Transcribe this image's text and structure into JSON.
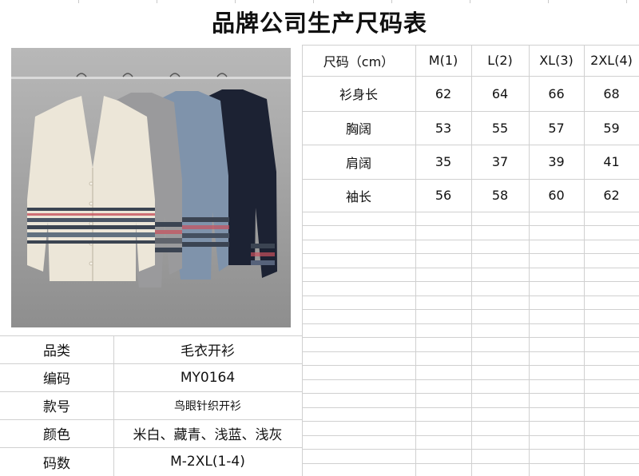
{
  "title": "品牌公司生产尺码表",
  "size_table": {
    "header_label": "尺码（cm）",
    "sizes": [
      "M(1)",
      "L(2)",
      "XL(3)",
      "2XL(4)"
    ],
    "rows": [
      {
        "label": "衫身长",
        "values": [
          "62",
          "64",
          "66",
          "68"
        ]
      },
      {
        "label": "胸阔",
        "values": [
          "53",
          "55",
          "57",
          "59"
        ]
      },
      {
        "label": "肩阔",
        "values": [
          "35",
          "37",
          "39",
          "41"
        ]
      },
      {
        "label": "袖长",
        "values": [
          "56",
          "58",
          "60",
          "62"
        ]
      }
    ]
  },
  "product_info": [
    {
      "label": "品类",
      "value": "毛衣开衫"
    },
    {
      "label": "编码",
      "value": "MY0164"
    },
    {
      "label": "款号",
      "value": "鸟眼针织开衫"
    },
    {
      "label": "颜色",
      "value": "米白、藏青、浅蓝、浅灰"
    },
    {
      "label": "码数",
      "value": "M-2XL(1-4)"
    }
  ],
  "photo": {
    "cardigan_colors": [
      "#ece6d8",
      "#9a9a9c",
      "#7f93ab",
      "#1c2233"
    ],
    "stripe_colors": [
      "#3b4452",
      "#c7505c",
      "#ffffff",
      "#607080"
    ]
  }
}
